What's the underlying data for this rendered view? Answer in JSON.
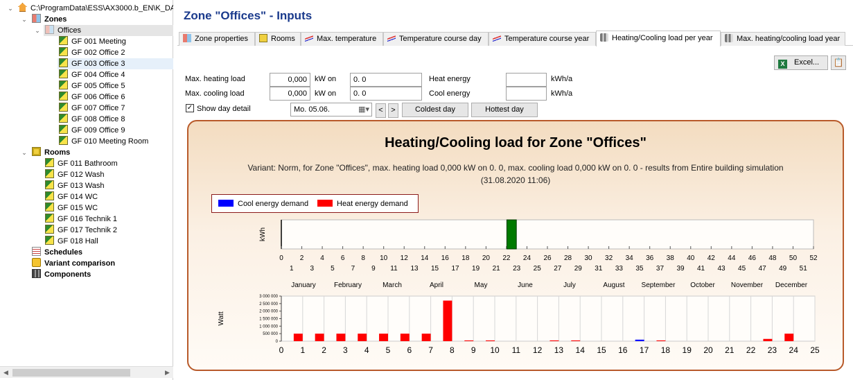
{
  "tree": {
    "root_path": "C:\\ProgramData\\ESS\\AX3000.b_EN\\K_DAT",
    "zones_label": "Zones",
    "offices_label": "Offices",
    "zone_items": [
      "GF 001 Meeting",
      "GF 002 Office 2",
      "GF 003 Office 3",
      "GF 004 Office 4",
      "GF 005 Office 5",
      "GF 006 Office 6",
      "GF 007 Office 7",
      "GF 008 Office 8",
      "GF 009 Office 9",
      "GF 010 Meeting Room"
    ],
    "rooms_label": "Rooms",
    "room_items": [
      "GF 011 Bathroom",
      "GF 012 Wash",
      "GF 013 Wash",
      "GF 014 WC",
      "GF 015 WC",
      "GF 016 Technik 1",
      "GF 017 Technik 2",
      "GF 018 Hall"
    ],
    "schedules_label": "Schedules",
    "variant_label": "Variant comparison",
    "components_label": "Components"
  },
  "header": {
    "title": "Zone \"Offices\" - Inputs"
  },
  "tabs": [
    "Zone properties",
    "Rooms",
    "Max. temperature",
    "Temperature course day",
    "Temperature course year",
    "Heating/Cooling load per year",
    "Max. heating/cooling load year"
  ],
  "active_tab": 5,
  "toolbar": {
    "excel_label": "Excel..."
  },
  "form": {
    "max_heating_label": "Max. heating load",
    "max_heating_value": "0,000",
    "max_cooling_label": "Max. cooling load",
    "max_cooling_value": "0,000",
    "kw_on": "kW on",
    "heating_date": "0. 0",
    "cooling_date": "0. 0",
    "heat_energy_label": "Heat energy",
    "cool_energy_label": "Cool energy",
    "heat_energy_value": "",
    "cool_energy_value": "",
    "unit_kwh": "kWh/a",
    "show_day_label": "Show day detail",
    "show_day_checked": true,
    "date_value": "Mo. 05.06.",
    "prev_label": "<",
    "next_label": ">",
    "coldest_label": "Coldest day",
    "hottest_label": "Hottest day"
  },
  "chart_title": "Heating/Cooling load for Zone \"Offices\"",
  "chart_subtitle": "Variant: Norm, for Zone \"Offices\", max. heating load 0,000 kW on 0. 0, max. cooling load 0,000 kW on 0. 0 - results from Entire building simulation (31.08.2020 11:06)",
  "legend": {
    "cool": "Cool energy demand",
    "heat": "Heat energy demand"
  },
  "colors": {
    "cool": "#0000ff",
    "heat": "#ff0000",
    "week_marker": "#007a00",
    "title": "#1a3a8c"
  },
  "chart_data": [
    {
      "type": "bar",
      "ylabel": "kWh",
      "xlim": [
        0,
        52
      ],
      "x_ticks_even": [
        0,
        2,
        4,
        6,
        8,
        10,
        12,
        14,
        16,
        18,
        20,
        22,
        24,
        26,
        28,
        30,
        32,
        34,
        36,
        38,
        40,
        42,
        44,
        46,
        48,
        50,
        52
      ],
      "x_ticks_odd": [
        1,
        3,
        5,
        7,
        9,
        11,
        13,
        15,
        17,
        19,
        21,
        23,
        25,
        27,
        29,
        31,
        33,
        35,
        37,
        39,
        41,
        43,
        45,
        47,
        49,
        51
      ],
      "months": [
        "January",
        "February",
        "March",
        "April",
        "May",
        "June",
        "July",
        "August",
        "September",
        "October",
        "November",
        "December"
      ],
      "highlight_week": 23
    },
    {
      "type": "bar",
      "ylabel": "Watt",
      "xlim": [
        0,
        25
      ],
      "ylim": [
        0,
        3000000
      ],
      "y_ticks": [
        "3 000 000",
        "2 500 000",
        "2 000 000",
        "1 500 000",
        "1 000 000",
        "500 000",
        "0"
      ],
      "x_ticks": [
        0,
        1,
        2,
        3,
        4,
        5,
        6,
        7,
        8,
        9,
        10,
        11,
        12,
        13,
        14,
        15,
        16,
        17,
        18,
        19,
        20,
        21,
        22,
        23,
        24,
        25
      ],
      "series": [
        {
          "name": "Heat energy demand",
          "hours": [
            1,
            2,
            3,
            4,
            5,
            6,
            7,
            8,
            9,
            10,
            13,
            14,
            18,
            23,
            24
          ],
          "values": [
            500000,
            500000,
            500000,
            500000,
            500000,
            500000,
            500000,
            2700000,
            50000,
            50000,
            50000,
            50000,
            50000,
            150000,
            500000
          ]
        },
        {
          "name": "Cool energy demand",
          "hours": [
            17
          ],
          "values": [
            100000
          ]
        }
      ]
    }
  ]
}
